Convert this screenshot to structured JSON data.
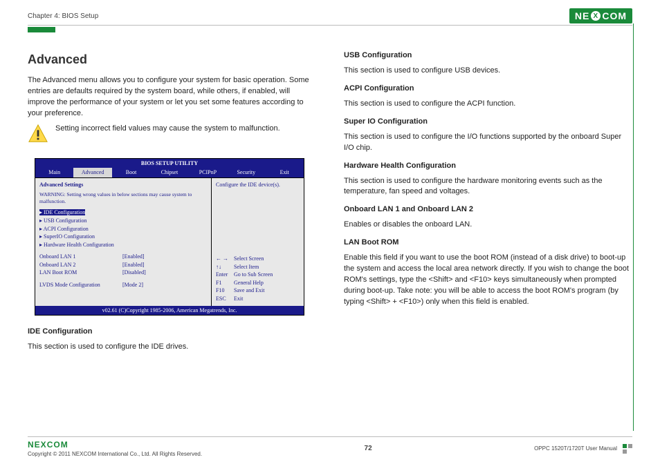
{
  "header": {
    "chapter": "Chapter 4: BIOS Setup",
    "logo_text_left": "NE",
    "logo_text_x": "X",
    "logo_text_right": "COM"
  },
  "left": {
    "title": "Advanced",
    "intro": "The Advanced menu allows you to configure your system for basic operation. Some entries are defaults required by the system board, while others, if enabled, will improve the performance of your system or let you set some features according to your preference.",
    "warning": "Setting incorrect field values may cause the system to malfunction.",
    "ide_head": "IDE Configuration",
    "ide_text": "This section is used to configure the IDE drives."
  },
  "bios": {
    "title": "BIOS SETUP UTILITY",
    "tabs": [
      "Main",
      "Advanced",
      "Boot",
      "Chipset",
      "PCIPnP",
      "Security",
      "Exit"
    ],
    "heading": "Advanced Settings",
    "warning": "WARNING:  Setting wrong values in below sections may cause system to malfunction.",
    "menu": [
      "IDE Configuration",
      "USB Configuration",
      "ACPI Configuration",
      "SuperIO Configuration",
      "Hardware Health Configuration"
    ],
    "settings": [
      {
        "k": "Onboard LAN 1",
        "v": "[Enabled]"
      },
      {
        "k": "Onboard LAN 2",
        "v": "[Enabled]"
      },
      {
        "k": "LAN Boot ROM",
        "v": "[Disabled]"
      }
    ],
    "lvds": {
      "k": "LVDS Mode Configuration",
      "v": "[Mode 2]"
    },
    "right_help_top": "Configure the IDE device(s).",
    "help": [
      {
        "k": "← →",
        "v": "Select Screen"
      },
      {
        "k": "↑↓",
        "v": "Select Item"
      },
      {
        "k": "Enter",
        "v": "Go to Sub Screen"
      },
      {
        "k": "F1",
        "v": "General Help"
      },
      {
        "k": "F10",
        "v": "Save and Exit"
      },
      {
        "k": "ESC",
        "v": "Exit"
      }
    ],
    "footer": "v02.61 (C)Copyright 1985-2006, American Megatrends, Inc."
  },
  "right": {
    "usb_head": "USB Configuration",
    "usb_text": "This section is used to configure USB devices.",
    "acpi_head": "ACPI Configuration",
    "acpi_text": "This section is used to configure the ACPI function.",
    "sio_head": "Super IO Configuration",
    "sio_text": "This section is used to configure the I/O functions supported by the onboard Super I/O chip.",
    "hw_head": "Hardware Health Configuration",
    "hw_text": "This section is used to configure the hardware monitoring events such as the temperature, fan speed and voltages.",
    "lan_head": "Onboard LAN 1 and Onboard LAN 2",
    "lan_text": "Enables or disables the onboard LAN.",
    "rom_head": "LAN Boot ROM",
    "rom_text": "Enable this field if you want to use the boot ROM (instead of a disk drive) to boot-up the system and access the local area network directly. If you wish to change the boot ROM's settings, type the <Shift> and <F10> keys simultaneously when prompted during boot-up. Take note: you will be able to access the boot ROM's program (by typing <Shift> + <F10>) only when this field is enabled."
  },
  "footer": {
    "copyright": "Copyright © 2011 NEXCOM International Co., Ltd. All Rights Reserved.",
    "page": "72",
    "manual": "OPPC 1520T/1720T User Manual",
    "logo_text_left": "NE",
    "logo_text_x": "X",
    "logo_text_right": "COM"
  }
}
